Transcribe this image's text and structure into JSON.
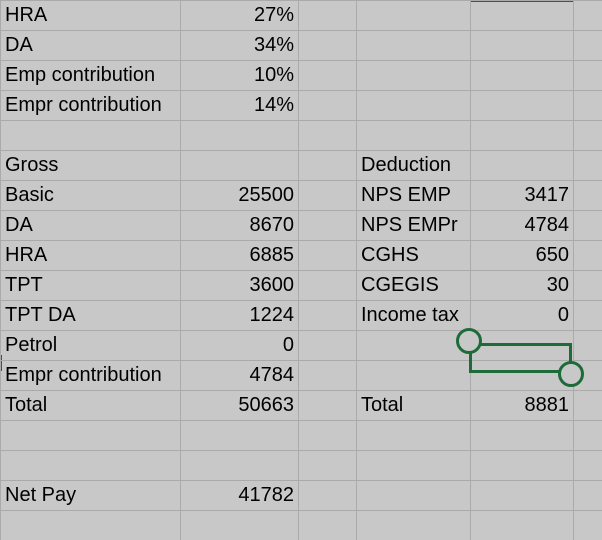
{
  "rates": [
    {
      "label": "HRA",
      "value": "27%"
    },
    {
      "label": "DA",
      "value": "34%"
    },
    {
      "label": "Emp contribution",
      "value": "10%"
    },
    {
      "label": "Empr contribution",
      "value": "14%"
    }
  ],
  "gross": {
    "header": "Gross",
    "items": [
      {
        "label": "Basic",
        "value": "25500"
      },
      {
        "label": "DA",
        "value": "8670"
      },
      {
        "label": "HRA",
        "value": "6885"
      },
      {
        "label": "TPT",
        "value": "3600"
      },
      {
        "label": "TPT DA",
        "value": "1224"
      },
      {
        "label": "Petrol",
        "value": "0"
      },
      {
        "label": "Empr contribution",
        "value": "4784"
      }
    ],
    "total_label": "Total",
    "total_value": "50663"
  },
  "deduction": {
    "header": "Deduction",
    "items": [
      {
        "label": "NPS EMP",
        "value": "3417"
      },
      {
        "label": "NPS EMPr",
        "value": "4784"
      },
      {
        "label": "CGHS",
        "value": "650"
      },
      {
        "label": "CGEGIS",
        "value": "30"
      },
      {
        "label": "Income tax",
        "value": "0"
      }
    ],
    "total_label": "Total",
    "total_value": "8881"
  },
  "net_pay": {
    "label": "Net Pay",
    "value": "41782"
  },
  "colors": {
    "sheet_bg": "#c8c8c8",
    "gridline": "#aaaaaa",
    "selection": "#1e6b3a"
  }
}
